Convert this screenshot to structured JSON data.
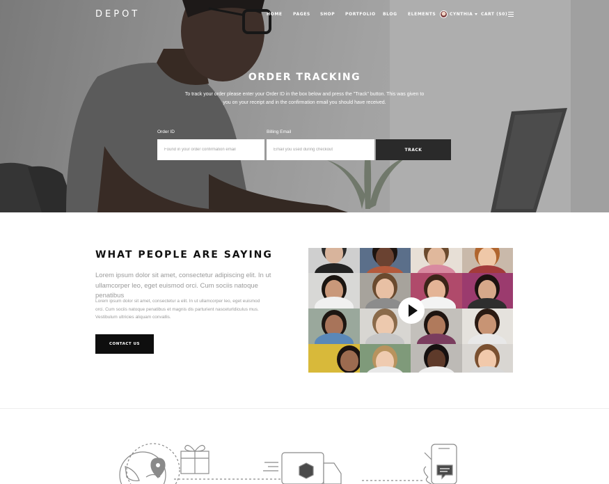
{
  "nav": {
    "logo": "DEPOT",
    "items": [
      "HOME",
      "PAGES",
      "SHOP",
      "PORTFOLIO",
      "BLOG",
      "ELEMENTS"
    ],
    "user": "CYNTHIA",
    "cart": "CART (S0)"
  },
  "hero": {
    "title": "ORDER TRACKING",
    "description": "To track your order please enter your Order ID in the box below and press the \"Track\" button. This was given to you on your receipt and in the confirmation email you should have received.",
    "order_id_label": "Order ID",
    "order_id_placeholder": "Found in your order confirmation email",
    "email_label": "Billing Email",
    "email_placeholder": "Email you used during checkout",
    "track_button": "TRACK"
  },
  "testimonials": {
    "title": "WHAT PEOPLE ARE SAYING",
    "lead": "Lorem ipsum dolor sit amet, consectetur adipiscing elit. In ut ullamcorper leo, eget euismod orci. Cum sociis natoque penatibus",
    "body": "Lorem ipsum dolor sit amet, consectetur a elit. In ut ullamcorper leo, eget euismod orci. Cum sociis natoque penatibus et magnis dis parturient nasceturldiculus mus. Vestibulum ultricies aliquam convallis.",
    "contact_button": "CONTACT US",
    "video_icon": "play-icon"
  },
  "colors": {
    "dark_button": "#2a2a2a",
    "contact_button": "#0e0e0e",
    "muted_text": "#9a9a9a"
  }
}
